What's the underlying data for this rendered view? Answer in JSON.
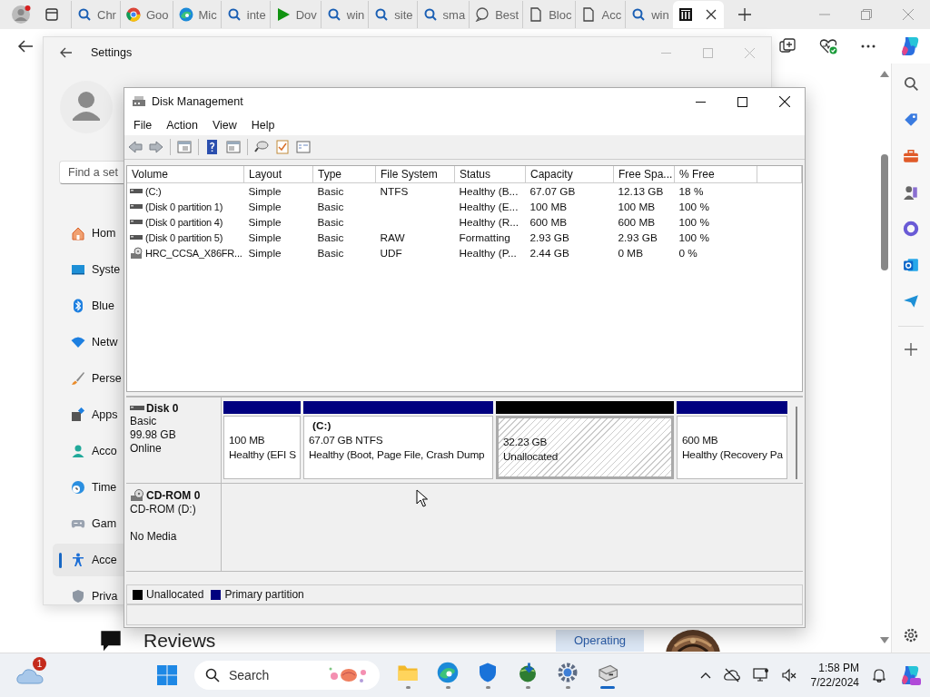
{
  "browser": {
    "tabs": [
      {
        "label": "Chr",
        "selected": false
      },
      {
        "label": "Goo",
        "selected": false
      },
      {
        "label": "Mic",
        "selected": false
      },
      {
        "label": "inte",
        "selected": false
      },
      {
        "label": "Dov",
        "selected": false
      },
      {
        "label": "win",
        "selected": false
      },
      {
        "label": "site",
        "selected": false
      },
      {
        "label": "sma",
        "selected": false
      },
      {
        "label": "Best",
        "selected": false
      },
      {
        "label": "Bloc",
        "selected": false
      },
      {
        "label": "Acc",
        "selected": false
      },
      {
        "label": "win",
        "selected": false
      },
      {
        "selected": true
      }
    ],
    "page": {
      "heading": "Reviews",
      "tag": "Operating"
    }
  },
  "settings": {
    "title": "Settings",
    "search": {
      "placeholder": "Find a set"
    },
    "nav": [
      {
        "label": "Hom",
        "selected": false
      },
      {
        "label": "Syste",
        "selected": false
      },
      {
        "label": "Blue",
        "selected": false
      },
      {
        "label": "Netw",
        "selected": false
      },
      {
        "label": "Perse",
        "selected": false
      },
      {
        "label": "Apps",
        "selected": false
      },
      {
        "label": "Acco",
        "selected": false
      },
      {
        "label": "Time",
        "selected": false
      },
      {
        "label": "Gam",
        "selected": false
      },
      {
        "label": "Acce",
        "selected": true
      },
      {
        "label": "Priva",
        "selected": false
      }
    ]
  },
  "disk_management": {
    "title": "Disk Management",
    "menu": [
      "File",
      "Action",
      "View",
      "Help"
    ],
    "columns": [
      "Volume",
      "Layout",
      "Type",
      "File System",
      "Status",
      "Capacity",
      "Free Spa...",
      "% Free"
    ],
    "rows": [
      {
        "kind": "disk",
        "cells": [
          "(C:)",
          "Simple",
          "Basic",
          "NTFS",
          "Healthy (B...",
          "67.07 GB",
          "12.13 GB",
          "18 %"
        ]
      },
      {
        "kind": "disk",
        "cells": [
          "(Disk 0 partition 1)",
          "Simple",
          "Basic",
          "",
          "Healthy (E...",
          "100 MB",
          "100 MB",
          "100 %"
        ]
      },
      {
        "kind": "disk",
        "cells": [
          "(Disk 0 partition 4)",
          "Simple",
          "Basic",
          "",
          "Healthy (R...",
          "600 MB",
          "600 MB",
          "100 %"
        ]
      },
      {
        "kind": "disk",
        "cells": [
          "(Disk 0 partition 5)",
          "Simple",
          "Basic",
          "RAW",
          "Formatting",
          "2.93 GB",
          "2.93 GB",
          "100 %"
        ]
      },
      {
        "kind": "cdrom",
        "cells": [
          "HRC_CCSA_X86FR...",
          "Simple",
          "Basic",
          "UDF",
          "Healthy (P...",
          "2.44 GB",
          "0 MB",
          "0 %"
        ]
      }
    ],
    "disks": [
      {
        "kind": "disk",
        "name": "Disk 0",
        "lines": [
          "Basic",
          "99.98 GB",
          "Online"
        ],
        "partitions": [
          {
            "kind": "primary",
            "lines": [
              "100 MB",
              "Healthy (EFI S"
            ]
          },
          {
            "kind": "primary",
            "name": "(C:)",
            "lines": [
              "67.07 GB NTFS",
              "Healthy (Boot, Page File, Crash Dump"
            ]
          },
          {
            "kind": "unallocated",
            "lines": [
              "32.23 GB",
              "Unallocated"
            ]
          },
          {
            "kind": "primary",
            "lines": [
              "600 MB",
              "Healthy (Recovery Pa"
            ]
          }
        ]
      },
      {
        "kind": "cdrom",
        "name": "CD-ROM 0",
        "lines": [
          "CD-ROM (D:)",
          "No Media"
        ]
      }
    ],
    "legend": [
      {
        "label": "Unallocated",
        "color": "#000000"
      },
      {
        "label": "Primary partition",
        "color": "#00007f"
      }
    ]
  },
  "taskbar": {
    "weather_badge": "1",
    "search": {
      "placeholder": "Search"
    },
    "apps": [
      {
        "selected": false
      },
      {
        "selected": false
      },
      {
        "selected": false
      },
      {
        "selected": false
      },
      {
        "selected": false
      },
      {
        "selected": true
      }
    ],
    "time": "1:58 PM",
    "date": "7/22/2024"
  }
}
